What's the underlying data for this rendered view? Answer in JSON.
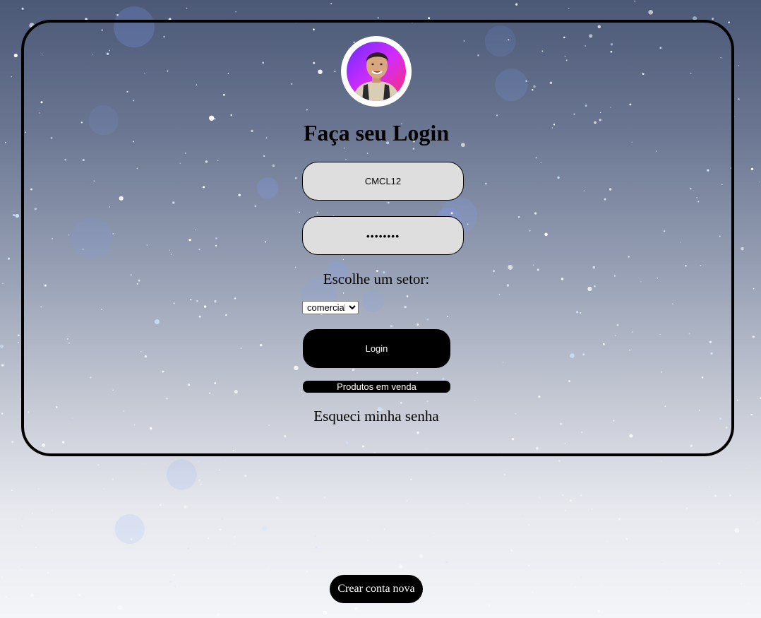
{
  "login": {
    "title": "Faça seu Login",
    "username_value": "CMCL12",
    "password_value": "••••••••",
    "setor_label": "Escolhe um setor:",
    "setor_selected": "comercial",
    "login_button": "Login",
    "produtos_button": "Produtos em venda",
    "forgot_link": "Esqueci minha senha"
  },
  "footer": {
    "create_account_button": "Crear conta nova"
  },
  "icons": {
    "avatar": "profile-photo-avatar"
  },
  "colors": {
    "button_bg": "#000000",
    "input_bg": "#dedede",
    "avatar_gradient_start": "#ff2e9a",
    "avatar_gradient_end": "#6a2cff"
  }
}
